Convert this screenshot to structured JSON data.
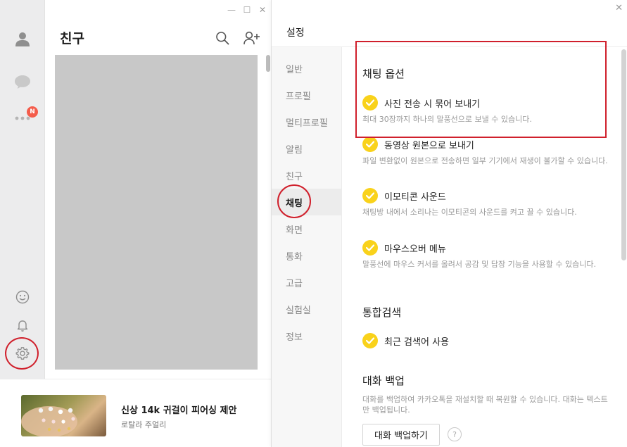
{
  "window_controls": {
    "minimize": "—",
    "maximize": "☐",
    "close": "✕"
  },
  "rail": {
    "badge": "N",
    "icons": [
      "person-icon",
      "chat-icon",
      "more-icon",
      "emoticon-icon",
      "bell-icon",
      "gear-icon"
    ]
  },
  "friends": {
    "title": "친구"
  },
  "ad": {
    "title": "신상 14k 귀걸이 피어싱 제안",
    "subtitle": "로탈라 주얼리"
  },
  "settings": {
    "title": "설정",
    "close": "✕",
    "nav": [
      {
        "label": "일반"
      },
      {
        "label": "프로필"
      },
      {
        "label": "멀티프로필"
      },
      {
        "label": "알림"
      },
      {
        "label": "친구"
      },
      {
        "label": "채팅",
        "active": true
      },
      {
        "label": "화면"
      },
      {
        "label": "통화"
      },
      {
        "label": "고급"
      },
      {
        "label": "실험실"
      },
      {
        "label": "정보"
      }
    ],
    "chat_options": {
      "title": "채팅 옵션",
      "items": [
        {
          "label": "사진 전송 시 묶어 보내기",
          "desc": "최대 30장까지 하나의 말풍선으로 보낼 수 있습니다.",
          "checked": true
        },
        {
          "label": "동영상 원본으로 보내기",
          "desc": "파일 변환없이 원본으로 전송하면 일부 기기에서 재생이 불가할 수 있습니다.",
          "checked": true
        },
        {
          "label": "이모티콘 사운드",
          "desc": "채팅방 내에서 소리나는 이모티콘의 사운드를 켜고 끌 수 있습니다.",
          "checked": true
        },
        {
          "label": "마우스오버 메뉴",
          "desc": "말풍선에 마우스 커서를 올려서 공감 및 답장 기능을 사용할 수 있습니다.",
          "checked": true
        }
      ]
    },
    "search": {
      "title": "통합검색",
      "items": [
        {
          "label": "최근 검색어 사용",
          "checked": true
        }
      ]
    },
    "backup": {
      "title": "대화 백업",
      "desc": "대화를 백업하여 카카오톡을 재설치할 때 복원할 수 있습니다. 대화는 텍스트만 백업됩니다.",
      "button": "대화 백업하기",
      "help": "?"
    }
  },
  "colors": {
    "check_yellow": "#f9d21b",
    "annotation_red": "#d0202c",
    "badge_red": "#f45c4b"
  }
}
